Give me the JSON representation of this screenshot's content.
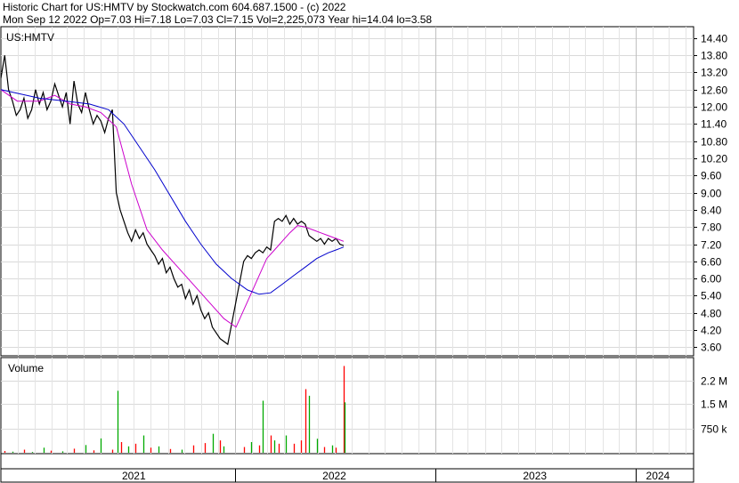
{
  "header": {
    "line1": "Historic Chart for US:HMTV by Stockwatch.com 604.687.1500 - (c) 2022",
    "line2": "Mon Sep 12 2022   Op=7.03   Hi=7.18   Lo=7.03   Cl=7.15   Vol=2,225,073   Year hi=14.04   lo=3.58"
  },
  "chart_data": {
    "type": "line",
    "symbol_label": "US:HMTV",
    "volume_label": "Volume",
    "price_axis": {
      "min": 3.3,
      "max": 14.8,
      "ticks": [
        "14.40",
        "13.80",
        "13.20",
        "12.60",
        "12.00",
        "11.40",
        "10.80",
        "10.20",
        "9.60",
        "9.00",
        "8.40",
        "7.80",
        "7.20",
        "6.60",
        "6.00",
        "5.40",
        "4.80",
        "4.20",
        "3.60"
      ]
    },
    "volume_axis": {
      "max": 2.85,
      "ticks": [
        {
          "label": "2.2 M",
          "value": 2.2
        },
        {
          "label": "1.5 M",
          "value": 1.5
        },
        {
          "label": "750 k",
          "value": 0.75
        }
      ]
    },
    "x_axis": {
      "start": "2020-11-01",
      "end": "2024-04-15",
      "year_labels": [
        {
          "label": "2021",
          "date": "2021-07-01"
        },
        {
          "label": "2022",
          "date": "2022-07-01"
        },
        {
          "label": "2023",
          "date": "2023-07-01"
        },
        {
          "label": "2024",
          "date": "2024-02-10"
        }
      ],
      "year_boundaries": [
        "2022-01-01",
        "2023-01-01",
        "2024-01-01"
      ]
    },
    "series": [
      {
        "color": "#000000",
        "points": [
          [
            "2020-11-01",
            13.0
          ],
          [
            "2020-11-08",
            13.8
          ],
          [
            "2020-11-15",
            12.6
          ],
          [
            "2020-11-22",
            12.2
          ],
          [
            "2020-11-29",
            11.7
          ],
          [
            "2020-12-06",
            11.9
          ],
          [
            "2020-12-13",
            12.3
          ],
          [
            "2020-12-20",
            11.6
          ],
          [
            "2020-12-27",
            11.9
          ],
          [
            "2021-01-03",
            12.6
          ],
          [
            "2021-01-10",
            12.1
          ],
          [
            "2021-01-17",
            12.5
          ],
          [
            "2021-01-24",
            11.9
          ],
          [
            "2021-01-31",
            12.2
          ],
          [
            "2021-02-07",
            12.8
          ],
          [
            "2021-02-14",
            12.4
          ],
          [
            "2021-02-21",
            12.0
          ],
          [
            "2021-02-28",
            12.5
          ],
          [
            "2021-03-07",
            11.4
          ],
          [
            "2021-03-14",
            12.9
          ],
          [
            "2021-03-21",
            12.1
          ],
          [
            "2021-03-28",
            11.8
          ],
          [
            "2021-04-04",
            12.5
          ],
          [
            "2021-04-11",
            11.9
          ],
          [
            "2021-04-18",
            11.4
          ],
          [
            "2021-04-25",
            11.7
          ],
          [
            "2021-05-02",
            11.5
          ],
          [
            "2021-05-09",
            11.1
          ],
          [
            "2021-05-16",
            11.6
          ],
          [
            "2021-05-23",
            11.9
          ],
          [
            "2021-05-30",
            9.0
          ],
          [
            "2021-06-06",
            8.4
          ],
          [
            "2021-06-13",
            8.0
          ],
          [
            "2021-06-20",
            7.6
          ],
          [
            "2021-06-27",
            7.3
          ],
          [
            "2021-07-04",
            7.7
          ],
          [
            "2021-07-11",
            7.4
          ],
          [
            "2021-07-18",
            7.6
          ],
          [
            "2021-07-25",
            7.2
          ],
          [
            "2021-08-01",
            7.0
          ],
          [
            "2021-08-08",
            6.8
          ],
          [
            "2021-08-15",
            6.5
          ],
          [
            "2021-08-22",
            6.7
          ],
          [
            "2021-08-29",
            6.2
          ],
          [
            "2021-09-05",
            6.4
          ],
          [
            "2021-09-12",
            6.0
          ],
          [
            "2021-09-19",
            5.7
          ],
          [
            "2021-09-26",
            5.8
          ],
          [
            "2021-10-03",
            5.3
          ],
          [
            "2021-10-10",
            5.6
          ],
          [
            "2021-10-17",
            5.1
          ],
          [
            "2021-10-24",
            5.4
          ],
          [
            "2021-10-31",
            4.9
          ],
          [
            "2021-11-07",
            4.6
          ],
          [
            "2021-11-14",
            4.8
          ],
          [
            "2021-11-21",
            4.3
          ],
          [
            "2021-11-28",
            4.1
          ],
          [
            "2021-12-05",
            3.9
          ],
          [
            "2021-12-12",
            3.8
          ],
          [
            "2021-12-19",
            3.7
          ],
          [
            "2022-01-17",
            6.6
          ],
          [
            "2022-01-24",
            6.8
          ],
          [
            "2022-01-31",
            6.7
          ],
          [
            "2022-02-07",
            6.9
          ],
          [
            "2022-02-14",
            7.0
          ],
          [
            "2022-02-21",
            6.9
          ],
          [
            "2022-02-28",
            7.1
          ],
          [
            "2022-03-07",
            7.0
          ],
          [
            "2022-03-14",
            8.0
          ],
          [
            "2022-03-21",
            8.1
          ],
          [
            "2022-03-28",
            8.0
          ],
          [
            "2022-04-04",
            8.2
          ],
          [
            "2022-04-11",
            7.9
          ],
          [
            "2022-04-18",
            8.1
          ],
          [
            "2022-04-25",
            7.9
          ],
          [
            "2022-05-02",
            8.0
          ],
          [
            "2022-05-09",
            7.9
          ],
          [
            "2022-05-16",
            7.5
          ],
          [
            "2022-05-23",
            7.4
          ],
          [
            "2022-05-30",
            7.3
          ],
          [
            "2022-06-06",
            7.4
          ],
          [
            "2022-06-13",
            7.2
          ],
          [
            "2022-06-20",
            7.4
          ],
          [
            "2022-06-27",
            7.3
          ],
          [
            "2022-07-04",
            7.4
          ],
          [
            "2022-07-11",
            7.2
          ],
          [
            "2022-07-18",
            7.15
          ]
        ]
      },
      {
        "color": "#cc00cc",
        "points": [
          [
            "2020-11-01",
            12.6
          ],
          [
            "2020-12-01",
            12.2
          ],
          [
            "2021-01-10",
            12.2
          ],
          [
            "2021-02-07",
            12.4
          ],
          [
            "2021-03-07",
            12.1
          ],
          [
            "2021-04-04",
            12.0
          ],
          [
            "2021-05-02",
            11.8
          ],
          [
            "2021-05-30",
            11.3
          ],
          [
            "2021-06-27",
            9.3
          ],
          [
            "2021-07-25",
            7.7
          ],
          [
            "2021-08-22",
            7.0
          ],
          [
            "2021-09-19",
            6.4
          ],
          [
            "2021-10-17",
            5.8
          ],
          [
            "2021-11-14",
            5.2
          ],
          [
            "2021-12-12",
            4.6
          ],
          [
            "2022-01-03",
            4.3
          ],
          [
            "2022-02-07",
            5.8
          ],
          [
            "2022-02-28",
            6.7
          ],
          [
            "2022-03-14",
            7.0
          ],
          [
            "2022-03-28",
            7.3
          ],
          [
            "2022-04-11",
            7.6
          ],
          [
            "2022-04-25",
            7.85
          ],
          [
            "2022-05-09",
            7.8
          ],
          [
            "2022-05-23",
            7.7
          ],
          [
            "2022-06-06",
            7.6
          ],
          [
            "2022-06-20",
            7.5
          ],
          [
            "2022-07-04",
            7.4
          ],
          [
            "2022-07-18",
            7.3
          ]
        ]
      },
      {
        "color": "#0000cc",
        "points": [
          [
            "2020-11-01",
            12.6
          ],
          [
            "2021-01-10",
            12.3
          ],
          [
            "2021-02-28",
            12.2
          ],
          [
            "2021-04-11",
            12.1
          ],
          [
            "2021-05-16",
            11.9
          ],
          [
            "2021-06-13",
            11.4
          ],
          [
            "2021-07-11",
            10.6
          ],
          [
            "2021-08-08",
            9.8
          ],
          [
            "2021-09-05",
            8.9
          ],
          [
            "2021-10-03",
            8.0
          ],
          [
            "2021-10-31",
            7.2
          ],
          [
            "2021-11-28",
            6.5
          ],
          [
            "2021-12-26",
            6.0
          ],
          [
            "2022-01-24",
            5.6
          ],
          [
            "2022-02-14",
            5.45
          ],
          [
            "2022-03-07",
            5.5
          ],
          [
            "2022-03-28",
            5.8
          ],
          [
            "2022-04-18",
            6.1
          ],
          [
            "2022-05-09",
            6.4
          ],
          [
            "2022-05-30",
            6.7
          ],
          [
            "2022-06-20",
            6.9
          ],
          [
            "2022-07-04",
            7.0
          ],
          [
            "2022-07-18",
            7.1
          ]
        ]
      }
    ],
    "volume": [
      {
        "date": "2020-11-08",
        "v": 0.08,
        "color": "red"
      },
      {
        "date": "2020-11-22",
        "v": 0.06,
        "color": "green"
      },
      {
        "date": "2020-12-13",
        "v": 0.12,
        "color": "red"
      },
      {
        "date": "2020-12-27",
        "v": 0.05,
        "color": "green"
      },
      {
        "date": "2021-01-17",
        "v": 0.18,
        "color": "green"
      },
      {
        "date": "2021-01-31",
        "v": 0.09,
        "color": "red"
      },
      {
        "date": "2021-02-21",
        "v": 0.07,
        "color": "green"
      },
      {
        "date": "2021-03-14",
        "v": 0.15,
        "color": "red"
      },
      {
        "date": "2021-04-04",
        "v": 0.26,
        "color": "green"
      },
      {
        "date": "2021-04-18",
        "v": 0.1,
        "color": "red"
      },
      {
        "date": "2021-05-02",
        "v": 0.46,
        "color": "green"
      },
      {
        "date": "2021-05-23",
        "v": 0.12,
        "color": "red"
      },
      {
        "date": "2021-06-01",
        "v": 1.9,
        "color": "green"
      },
      {
        "date": "2021-06-08",
        "v": 0.35,
        "color": "red"
      },
      {
        "date": "2021-06-20",
        "v": 0.22,
        "color": "green"
      },
      {
        "date": "2021-07-04",
        "v": 0.3,
        "color": "red"
      },
      {
        "date": "2021-07-18",
        "v": 0.55,
        "color": "green"
      },
      {
        "date": "2021-08-01",
        "v": 0.18,
        "color": "red"
      },
      {
        "date": "2021-08-15",
        "v": 0.22,
        "color": "green"
      },
      {
        "date": "2021-09-05",
        "v": 0.14,
        "color": "red"
      },
      {
        "date": "2021-09-26",
        "v": 0.12,
        "color": "green"
      },
      {
        "date": "2021-10-17",
        "v": 0.25,
        "color": "red"
      },
      {
        "date": "2021-11-07",
        "v": 0.32,
        "color": "red"
      },
      {
        "date": "2021-11-21",
        "v": 0.6,
        "color": "green"
      },
      {
        "date": "2021-12-05",
        "v": 0.4,
        "color": "red"
      },
      {
        "date": "2021-12-12",
        "v": 0.22,
        "color": "green"
      },
      {
        "date": "2022-01-17",
        "v": 0.2,
        "color": "red"
      },
      {
        "date": "2022-01-31",
        "v": 0.35,
        "color": "green"
      },
      {
        "date": "2022-02-14",
        "v": 0.25,
        "color": "red"
      },
      {
        "date": "2022-02-21",
        "v": 1.6,
        "color": "green"
      },
      {
        "date": "2022-03-07",
        "v": 0.55,
        "color": "red"
      },
      {
        "date": "2022-03-14",
        "v": 0.4,
        "color": "green"
      },
      {
        "date": "2022-03-21",
        "v": 0.3,
        "color": "red"
      },
      {
        "date": "2022-04-04",
        "v": 0.55,
        "color": "green"
      },
      {
        "date": "2022-04-18",
        "v": 0.3,
        "color": "red"
      },
      {
        "date": "2022-05-02",
        "v": 0.4,
        "color": "red"
      },
      {
        "date": "2022-05-09",
        "v": 1.95,
        "color": "red"
      },
      {
        "date": "2022-05-16",
        "v": 1.75,
        "color": "green"
      },
      {
        "date": "2022-05-30",
        "v": 0.45,
        "color": "green"
      },
      {
        "date": "2022-06-13",
        "v": 0.2,
        "color": "red"
      },
      {
        "date": "2022-06-27",
        "v": 0.25,
        "color": "green"
      },
      {
        "date": "2022-07-04",
        "v": 0.18,
        "color": "red"
      },
      {
        "date": "2022-07-18",
        "v": 2.65,
        "color": "red"
      },
      {
        "date": "2022-07-19",
        "v": 1.55,
        "color": "green"
      }
    ]
  }
}
